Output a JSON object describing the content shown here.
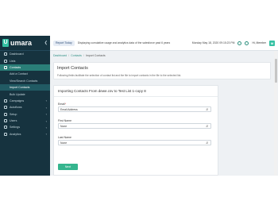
{
  "brand": {
    "name": "umara",
    "mark": "U"
  },
  "sidebar": {
    "items": [
      {
        "label": "Dashboard",
        "icon": "dashboard-icon"
      },
      {
        "label": "Lists",
        "icon": "list-icon"
      },
      {
        "label": "Contacts",
        "icon": "contacts-icon",
        "active": true
      },
      {
        "label": "Add a Contact",
        "sub": true
      },
      {
        "label": "View/Search Contacts",
        "sub": true
      },
      {
        "label": "Import Contacts",
        "sub": true,
        "active": true
      },
      {
        "label": "Bulk Update",
        "sub": true
      },
      {
        "label": "Campaigns",
        "icon": "campaign-icon",
        "caret": true
      },
      {
        "label": "Autoflows",
        "icon": "autoflow-icon",
        "caret": true
      },
      {
        "label": "Setup",
        "icon": "setup-icon",
        "caret": true
      },
      {
        "label": "Users",
        "icon": "users-icon",
        "caret": true
      },
      {
        "label": "Settings",
        "icon": "gear-icon",
        "caret": true
      },
      {
        "label": "Analytics",
        "icon": "analytics-icon",
        "caret": true
      }
    ]
  },
  "topbar": {
    "report_chip": "Report Today",
    "message": "Displaying cumulative usage and analytics data of the salesforce past 6 years",
    "date": "Monday May 18, 2020 09:15:23 PM",
    "user_name": "Hi, Member",
    "avatar_letter": "M"
  },
  "breadcrumb": {
    "home": "Dashboard",
    "parent": "Contacts",
    "current": "Import Contacts"
  },
  "header": {
    "title": "Import Contacts",
    "description": "Following fields facilitate the selection of contact list and the file to import contacts in the file to the selected list."
  },
  "form": {
    "title": "Importing Contacts From dewe.csv to Test List 1-copy 8",
    "fields": [
      {
        "label": "Email",
        "required": true,
        "value": "Email Address"
      },
      {
        "label": "First Name",
        "required": false,
        "value": "None"
      },
      {
        "label": "Last Name",
        "required": false,
        "value": "None"
      }
    ],
    "next_label": "Next"
  }
}
